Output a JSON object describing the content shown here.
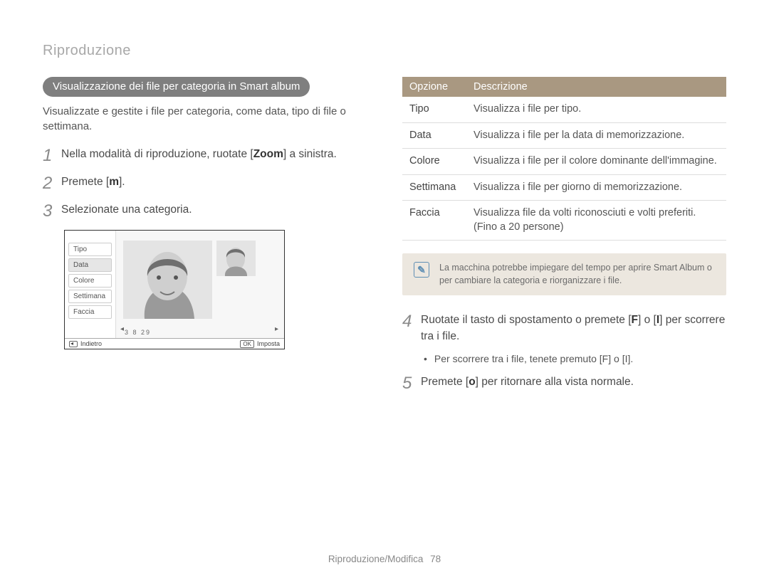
{
  "header": "Riproduzione",
  "pill": "Visualizzazione dei ﬁle per categoria in Smart album",
  "intro": "Visualizzate e gestite i file per categoria, come data, tipo di file o settimana.",
  "steps_left": {
    "s1_pre": "Nella modalità di riproduzione, ruotate [",
    "s1_bold": "Zoom",
    "s1_post": "] a sinistra.",
    "s2_pre": "Premete [",
    "s2_bold": "m",
    "s2_post": "].",
    "s3": "Selezionate una categoria."
  },
  "camera": {
    "menu": [
      "Tipo",
      "Data",
      "Colore",
      "Settimana",
      "Faccia"
    ],
    "date_line": "3   8              29",
    "back_label": "Indietro",
    "ok_key": "OK",
    "set_label": "Imposta"
  },
  "table": {
    "h1": "Opzione",
    "h2": "Descrizione",
    "rows": [
      {
        "opt": "Tipo",
        "desc": "Visualizza i file per tipo."
      },
      {
        "opt": "Data",
        "desc": "Visualizza i file per la data di memorizzazione."
      },
      {
        "opt": "Colore",
        "desc": "Visualizza i file per il colore dominante dell'immagine."
      },
      {
        "opt": "Settimana",
        "desc": "Visualizza i file per giorno di memorizzazione."
      },
      {
        "opt": "Faccia",
        "desc": "Visualizza file da volti riconosciuti e volti preferiti. (Fino a 20 persone)"
      }
    ]
  },
  "note": "La macchina potrebbe impiegare del tempo per aprire Smart Album o per cambiare la categoria e riorganizzare i file.",
  "steps_right": {
    "s4_pre": "Ruotate il tasto di spostamento o premete [",
    "s4_b1": "F",
    "s4_mid": "] o [",
    "s4_b2": "I",
    "s4_post": "] per scorrere tra i file.",
    "s4_sub_pre": "Per scorrere tra i file, tenete premuto [",
    "s4_sub_b1": "F",
    "s4_sub_mid": "] o [",
    "s4_sub_b2": "I",
    "s4_sub_post": "].",
    "s5_pre": "Premete [",
    "s5_bold": "o",
    "s5_post": "] per ritornare alla vista normale."
  },
  "footer": {
    "section": "Riproduzione/Modifica",
    "page": "78"
  }
}
